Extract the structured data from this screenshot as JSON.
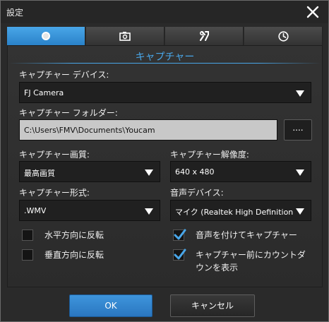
{
  "window": {
    "title": "設定"
  },
  "tabs": [
    {
      "icon": "radio-dot-icon",
      "active": true
    },
    {
      "icon": "camera-icon",
      "active": false
    },
    {
      "icon": "tools-icon",
      "active": false
    },
    {
      "icon": "clock-icon",
      "active": false
    }
  ],
  "section": {
    "title": "キャプチャー"
  },
  "device": {
    "label": "キャプチャー デバイス:",
    "value": "FJ Camera"
  },
  "folder": {
    "label": "キャプチャー フォルダー:",
    "path": "C:\\Users\\FMV\\Documents\\Youcam",
    "browse_label": "...."
  },
  "quality": {
    "label": "キャプチャー画質:",
    "value": "最高画質"
  },
  "resolution": {
    "label": "キャプチャー解像度:",
    "value": "640 x 480"
  },
  "format": {
    "label": "キャプチャー形式:",
    "value": ".WMV"
  },
  "audio": {
    "label": "音声デバイス:",
    "value": "マイク (Realtek High Definition A"
  },
  "checkboxes": {
    "flip_horizontal": {
      "label": "水平方向に反転",
      "checked": false
    },
    "flip_vertical": {
      "label": "垂直方向に反転",
      "checked": false
    },
    "capture_with_audio": {
      "label": "音声を付けてキャプチャー",
      "checked": true
    },
    "countdown": {
      "label_line1": "キャプチャー前にカウントダ",
      "label_line2": "ウンを表示",
      "checked": true
    }
  },
  "buttons": {
    "ok": "OK",
    "cancel": "キャンセル"
  },
  "colors": {
    "accent": "#49a6e8",
    "background": "#2a2a2a"
  }
}
